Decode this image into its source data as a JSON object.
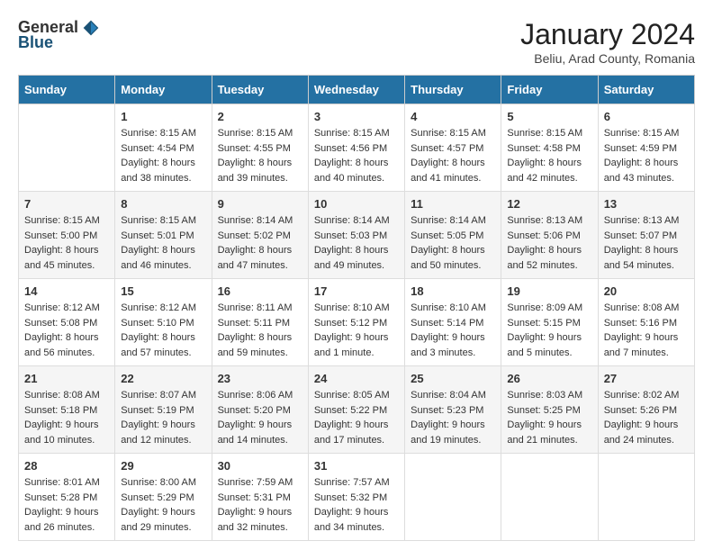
{
  "header": {
    "logo_general": "General",
    "logo_blue": "Blue",
    "title": "January 2024",
    "subtitle": "Beliu, Arad County, Romania"
  },
  "days_of_week": [
    "Sunday",
    "Monday",
    "Tuesday",
    "Wednesday",
    "Thursday",
    "Friday",
    "Saturday"
  ],
  "weeks": [
    [
      {
        "day": "",
        "info": ""
      },
      {
        "day": "1",
        "info": "Sunrise: 8:15 AM\nSunset: 4:54 PM\nDaylight: 8 hours\nand 38 minutes."
      },
      {
        "day": "2",
        "info": "Sunrise: 8:15 AM\nSunset: 4:55 PM\nDaylight: 8 hours\nand 39 minutes."
      },
      {
        "day": "3",
        "info": "Sunrise: 8:15 AM\nSunset: 4:56 PM\nDaylight: 8 hours\nand 40 minutes."
      },
      {
        "day": "4",
        "info": "Sunrise: 8:15 AM\nSunset: 4:57 PM\nDaylight: 8 hours\nand 41 minutes."
      },
      {
        "day": "5",
        "info": "Sunrise: 8:15 AM\nSunset: 4:58 PM\nDaylight: 8 hours\nand 42 minutes."
      },
      {
        "day": "6",
        "info": "Sunrise: 8:15 AM\nSunset: 4:59 PM\nDaylight: 8 hours\nand 43 minutes."
      }
    ],
    [
      {
        "day": "7",
        "info": "Sunrise: 8:15 AM\nSunset: 5:00 PM\nDaylight: 8 hours\nand 45 minutes."
      },
      {
        "day": "8",
        "info": "Sunrise: 8:15 AM\nSunset: 5:01 PM\nDaylight: 8 hours\nand 46 minutes."
      },
      {
        "day": "9",
        "info": "Sunrise: 8:14 AM\nSunset: 5:02 PM\nDaylight: 8 hours\nand 47 minutes."
      },
      {
        "day": "10",
        "info": "Sunrise: 8:14 AM\nSunset: 5:03 PM\nDaylight: 8 hours\nand 49 minutes."
      },
      {
        "day": "11",
        "info": "Sunrise: 8:14 AM\nSunset: 5:05 PM\nDaylight: 8 hours\nand 50 minutes."
      },
      {
        "day": "12",
        "info": "Sunrise: 8:13 AM\nSunset: 5:06 PM\nDaylight: 8 hours\nand 52 minutes."
      },
      {
        "day": "13",
        "info": "Sunrise: 8:13 AM\nSunset: 5:07 PM\nDaylight: 8 hours\nand 54 minutes."
      }
    ],
    [
      {
        "day": "14",
        "info": "Sunrise: 8:12 AM\nSunset: 5:08 PM\nDaylight: 8 hours\nand 56 minutes."
      },
      {
        "day": "15",
        "info": "Sunrise: 8:12 AM\nSunset: 5:10 PM\nDaylight: 8 hours\nand 57 minutes."
      },
      {
        "day": "16",
        "info": "Sunrise: 8:11 AM\nSunset: 5:11 PM\nDaylight: 8 hours\nand 59 minutes."
      },
      {
        "day": "17",
        "info": "Sunrise: 8:10 AM\nSunset: 5:12 PM\nDaylight: 9 hours\nand 1 minute."
      },
      {
        "day": "18",
        "info": "Sunrise: 8:10 AM\nSunset: 5:14 PM\nDaylight: 9 hours\nand 3 minutes."
      },
      {
        "day": "19",
        "info": "Sunrise: 8:09 AM\nSunset: 5:15 PM\nDaylight: 9 hours\nand 5 minutes."
      },
      {
        "day": "20",
        "info": "Sunrise: 8:08 AM\nSunset: 5:16 PM\nDaylight: 9 hours\nand 7 minutes."
      }
    ],
    [
      {
        "day": "21",
        "info": "Sunrise: 8:08 AM\nSunset: 5:18 PM\nDaylight: 9 hours\nand 10 minutes."
      },
      {
        "day": "22",
        "info": "Sunrise: 8:07 AM\nSunset: 5:19 PM\nDaylight: 9 hours\nand 12 minutes."
      },
      {
        "day": "23",
        "info": "Sunrise: 8:06 AM\nSunset: 5:20 PM\nDaylight: 9 hours\nand 14 minutes."
      },
      {
        "day": "24",
        "info": "Sunrise: 8:05 AM\nSunset: 5:22 PM\nDaylight: 9 hours\nand 17 minutes."
      },
      {
        "day": "25",
        "info": "Sunrise: 8:04 AM\nSunset: 5:23 PM\nDaylight: 9 hours\nand 19 minutes."
      },
      {
        "day": "26",
        "info": "Sunrise: 8:03 AM\nSunset: 5:25 PM\nDaylight: 9 hours\nand 21 minutes."
      },
      {
        "day": "27",
        "info": "Sunrise: 8:02 AM\nSunset: 5:26 PM\nDaylight: 9 hours\nand 24 minutes."
      }
    ],
    [
      {
        "day": "28",
        "info": "Sunrise: 8:01 AM\nSunset: 5:28 PM\nDaylight: 9 hours\nand 26 minutes."
      },
      {
        "day": "29",
        "info": "Sunrise: 8:00 AM\nSunset: 5:29 PM\nDaylight: 9 hours\nand 29 minutes."
      },
      {
        "day": "30",
        "info": "Sunrise: 7:59 AM\nSunset: 5:31 PM\nDaylight: 9 hours\nand 32 minutes."
      },
      {
        "day": "31",
        "info": "Sunrise: 7:57 AM\nSunset: 5:32 PM\nDaylight: 9 hours\nand 34 minutes."
      },
      {
        "day": "",
        "info": ""
      },
      {
        "day": "",
        "info": ""
      },
      {
        "day": "",
        "info": ""
      }
    ]
  ]
}
